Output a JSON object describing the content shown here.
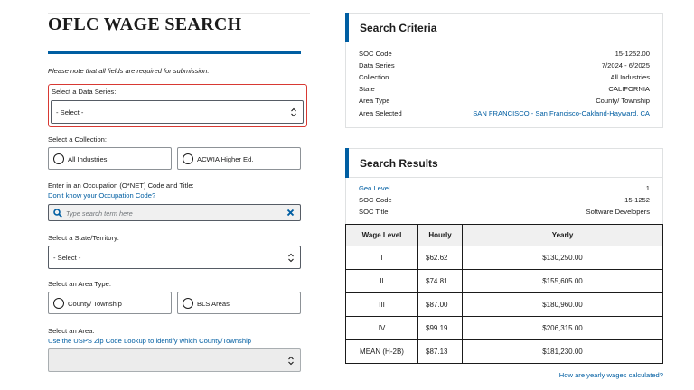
{
  "form": {
    "title": "OFLC WAGE SEARCH",
    "note": "Please note that all fields are required for submission.",
    "data_series": {
      "label": "Select a Data Series:",
      "value": "- Select -"
    },
    "collection": {
      "label": "Select a Collection:",
      "options": [
        "All Industries",
        "ACWIA Higher Ed."
      ]
    },
    "occupation": {
      "label": "Enter in an Occupation (O*NET) Code and Title:",
      "help_link": "Don't know your Occupation Code?",
      "placeholder": "Type search term here",
      "value": ""
    },
    "state": {
      "label": "Select a State/Territory:",
      "value": "- Select -"
    },
    "area_type": {
      "label": "Select an Area Type:",
      "options": [
        "County/ Township",
        "BLS Areas"
      ]
    },
    "area": {
      "label": "Select an Area:",
      "help_link": "Use the USPS Zip Code Lookup to identify which County/Township",
      "value": ""
    }
  },
  "criteria": {
    "title": "Search Criteria",
    "rows": [
      {
        "key": "SOC Code",
        "value": "15-1252.00"
      },
      {
        "key": "Data Series",
        "value": "7/2024 - 6/2025"
      },
      {
        "key": "Collection",
        "value": "All Industries"
      },
      {
        "key": "State",
        "value": "CALIFORNIA"
      },
      {
        "key": "Area Type",
        "value": "County/ Township"
      },
      {
        "key": "Area Selected",
        "value": "SAN FRANCISCO - San Francisco-Oakland-Hayward, CA"
      }
    ]
  },
  "results": {
    "title": "Search Results",
    "rows": [
      {
        "key": "Geo Level",
        "value": "1"
      },
      {
        "key": "SOC Code",
        "value": "15-1252"
      },
      {
        "key": "SOC Title",
        "value": "Software Developers"
      }
    ],
    "table": {
      "headers": [
        "Wage Level",
        "Hourly",
        "Yearly"
      ],
      "rows": [
        [
          "I",
          "$62.62",
          "$130,250.00"
        ],
        [
          "II",
          "$74.81",
          "$155,605.00"
        ],
        [
          "III",
          "$87.00",
          "$180,960.00"
        ],
        [
          "IV",
          "$99.19",
          "$206,315.00"
        ],
        [
          "MEAN (H-2B)",
          "$87.13",
          "$181,230.00"
        ]
      ]
    },
    "help_link": "How are yearly wages calculated?"
  },
  "colors": {
    "accent": "#005ea2",
    "highlight": "#d83933",
    "text": "#1b1b1b"
  },
  "icons": [
    "chevron-updown-icon",
    "search-icon",
    "clear-icon",
    "radio-icon"
  ]
}
